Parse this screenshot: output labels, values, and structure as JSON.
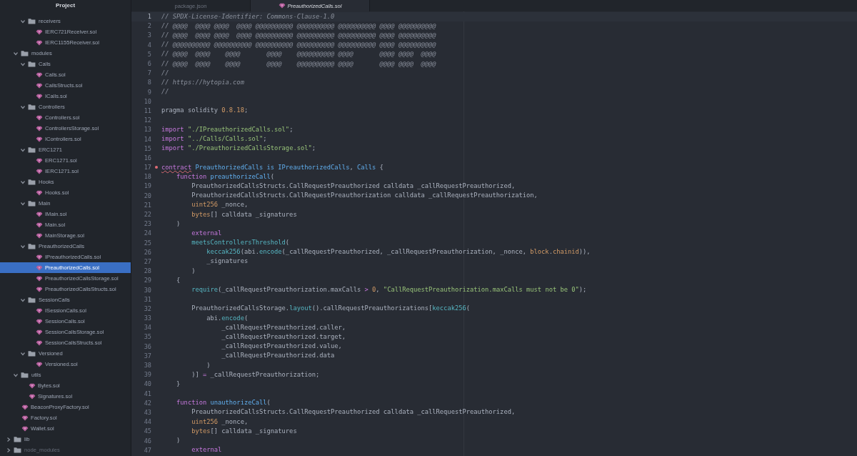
{
  "sidebar": {
    "title": "Project",
    "tree": [
      {
        "kind": "folder",
        "children": [
          {
            "kind": "folder",
            "children": [
              {
                "kind": "folder",
                "label": "receivers",
                "expanded": true,
                "children": [
                  {
                    "kind": "file",
                    "label": "IERC721Receiver.sol",
                    "selected": false
                  },
                  {
                    "kind": "file",
                    "label": "IERC1155Receiver.sol",
                    "selected": false
                  }
                ]
              }
            ]
          },
          {
            "kind": "folder",
            "label": "modules",
            "expanded": true,
            "children": [
              {
                "kind": "folder",
                "label": "Calls",
                "expanded": true,
                "children": [
                  {
                    "kind": "file",
                    "label": "Calls.sol",
                    "selected": false
                  },
                  {
                    "kind": "file",
                    "label": "CallsStructs.sol",
                    "selected": false
                  },
                  {
                    "kind": "file",
                    "label": "ICalls.sol",
                    "selected": false
                  }
                ]
              },
              {
                "kind": "folder",
                "label": "Controllers",
                "expanded": true,
                "children": [
                  {
                    "kind": "file",
                    "label": "Controllers.sol",
                    "selected": false
                  },
                  {
                    "kind": "file",
                    "label": "ControllersStorage.sol",
                    "selected": false
                  },
                  {
                    "kind": "file",
                    "label": "IControllers.sol",
                    "selected": false
                  }
                ]
              },
              {
                "kind": "folder",
                "label": "ERC1271",
                "expanded": true,
                "children": [
                  {
                    "kind": "file",
                    "label": "ERC1271.sol",
                    "selected": false
                  },
                  {
                    "kind": "file",
                    "label": "IERC1271.sol",
                    "selected": false
                  }
                ]
              },
              {
                "kind": "folder",
                "label": "Hooks",
                "expanded": true,
                "children": [
                  {
                    "kind": "file",
                    "label": "Hooks.sol",
                    "selected": false
                  }
                ]
              },
              {
                "kind": "folder",
                "label": "Main",
                "expanded": true,
                "children": [
                  {
                    "kind": "file",
                    "label": "IMain.sol",
                    "selected": false
                  },
                  {
                    "kind": "file",
                    "label": "Main.sol",
                    "selected": false
                  },
                  {
                    "kind": "file",
                    "label": "MainStorage.sol",
                    "selected": false
                  }
                ]
              },
              {
                "kind": "folder",
                "label": "PreauthorizedCalls",
                "expanded": true,
                "children": [
                  {
                    "kind": "file",
                    "label": "IPreauthorizedCalls.sol",
                    "selected": false
                  },
                  {
                    "kind": "file",
                    "label": "PreauthorizedCalls.sol",
                    "selected": true
                  },
                  {
                    "kind": "file",
                    "label": "PreauthorizedCallsStorage.sol",
                    "selected": false
                  },
                  {
                    "kind": "file",
                    "label": "PreauthorizedCallsStructs.sol",
                    "selected": false
                  }
                ]
              },
              {
                "kind": "folder",
                "label": "SessionCalls",
                "expanded": true,
                "children": [
                  {
                    "kind": "file",
                    "label": "ISessionCalls.sol",
                    "selected": false
                  },
                  {
                    "kind": "file",
                    "label": "SessionCalls.sol",
                    "selected": false
                  },
                  {
                    "kind": "file",
                    "label": "SessionCallsStorage.sol",
                    "selected": false
                  },
                  {
                    "kind": "file",
                    "label": "SessionCallsStructs.sol",
                    "selected": false
                  }
                ]
              },
              {
                "kind": "folder",
                "label": "Versioned",
                "expanded": true,
                "children": [
                  {
                    "kind": "file",
                    "label": "Versioned.sol",
                    "selected": false
                  }
                ]
              }
            ]
          },
          {
            "kind": "folder",
            "label": "utils",
            "expanded": true,
            "children": [
              {
                "kind": "file",
                "label": "Bytes.sol",
                "selected": false
              },
              {
                "kind": "file",
                "label": "Signatures.sol",
                "selected": false
              }
            ]
          },
          {
            "kind": "file",
            "label": "BeaconProxyFactory.sol",
            "selected": false
          },
          {
            "kind": "file",
            "label": "Factory.sol",
            "selected": false
          },
          {
            "kind": "file",
            "label": "Wallet.sol",
            "selected": false
          }
        ]
      },
      {
        "kind": "folder",
        "label": "lib",
        "expanded": false
      },
      {
        "kind": "folder",
        "label": "node_modules",
        "expanded": false,
        "ignored": true
      }
    ]
  },
  "tabs": [
    {
      "label": "package.json",
      "kind": "plain",
      "selected": false
    },
    {
      "label": "PreauthorizedCalls.sol",
      "kind": "solidity",
      "selected": true
    }
  ],
  "editor": {
    "lines": [
      {
        "number": "1",
        "current": true,
        "error": false,
        "tokens": [
          {
            "kind": "comment",
            "text": "// SPDX-License-Identifier: Commons-Clause-1.0"
          }
        ]
      },
      {
        "number": "2",
        "current": false,
        "error": false,
        "tokens": [
          {
            "kind": "comment",
            "text": "// @@@@  @@@@ @@@@  @@@@ @@@@@@@@@@ @@@@@@@@@@ @@@@@@@@@@ @@@@ @@@@@@@@@@"
          }
        ]
      },
      {
        "number": "3",
        "current": false,
        "error": false,
        "tokens": [
          {
            "kind": "comment",
            "text": "// @@@@  @@@@ @@@@  @@@@ @@@@@@@@@@ @@@@@@@@@@ @@@@@@@@@@ @@@@ @@@@@@@@@@"
          }
        ]
      },
      {
        "number": "4",
        "current": false,
        "error": false,
        "tokens": [
          {
            "kind": "comment",
            "text": "// @@@@@@@@@@ @@@@@@@@@@ @@@@@@@@@@ @@@@@@@@@@ @@@@@@@@@@ @@@@ @@@@@@@@@@"
          }
        ]
      },
      {
        "number": "5",
        "current": false,
        "error": false,
        "tokens": [
          {
            "kind": "comment",
            "text": "// @@@@  @@@@    @@@@       @@@@    @@@@@@@@@@ @@@@       @@@@ @@@@  @@@@"
          }
        ]
      },
      {
        "number": "6",
        "current": false,
        "error": false,
        "tokens": [
          {
            "kind": "comment",
            "text": "// @@@@  @@@@    @@@@       @@@@    @@@@@@@@@@ @@@@       @@@@ @@@@  @@@@"
          }
        ]
      },
      {
        "number": "7",
        "current": false,
        "error": false,
        "tokens": [
          {
            "kind": "comment",
            "text": "//"
          }
        ]
      },
      {
        "number": "8",
        "current": false,
        "error": false,
        "tokens": [
          {
            "kind": "comment",
            "text": "// https://hytopia.com"
          }
        ]
      },
      {
        "number": "9",
        "current": false,
        "error": false,
        "tokens": [
          {
            "kind": "comment",
            "text": "//"
          }
        ]
      },
      {
        "number": "10",
        "current": false,
        "error": false
      },
      {
        "number": "11",
        "current": false,
        "error": false,
        "tokens": [
          {
            "kind": "plain",
            "text": "pragma solidity "
          },
          {
            "kind": "number",
            "text": "0.8.18"
          },
          {
            "kind": "plain",
            "text": ";"
          }
        ]
      },
      {
        "number": "12",
        "current": false,
        "error": false
      },
      {
        "number": "13",
        "current": false,
        "error": false,
        "tokens": [
          {
            "kind": "keyword",
            "text": "import "
          },
          {
            "kind": "string",
            "text": "\"./IPreauthorizedCalls.sol\""
          },
          {
            "kind": "plain",
            "text": ";"
          }
        ]
      },
      {
        "number": "14",
        "current": false,
        "error": false,
        "tokens": [
          {
            "kind": "keyword",
            "text": "import "
          },
          {
            "kind": "string",
            "text": "\"../Calls/Calls.sol\""
          },
          {
            "kind": "plain",
            "text": ";"
          }
        ]
      },
      {
        "number": "15",
        "current": false,
        "error": false,
        "tokens": [
          {
            "kind": "keyword",
            "text": "import "
          },
          {
            "kind": "string",
            "text": "\"./PreauthorizedCallsStorage.sol\""
          },
          {
            "kind": "plain",
            "text": ";"
          }
        ]
      },
      {
        "number": "16",
        "current": false,
        "error": false
      },
      {
        "number": "17",
        "current": false,
        "error": true,
        "tokens": [
          {
            "kind": "keyword",
            "text": "contract"
          },
          {
            "kind": "name",
            "text": " PreauthorizedCalls is IPreauthorizedCalls"
          },
          {
            "kind": "plain",
            "text": ", "
          },
          {
            "kind": "name",
            "text": "Calls"
          },
          {
            "kind": "plain",
            "text": " {"
          }
        ]
      },
      {
        "number": "18",
        "current": false,
        "error": false,
        "tokens": [
          {
            "kind": "keyword",
            "text": "    function"
          },
          {
            "kind": "name",
            "text": " preauthorizeCall"
          },
          {
            "kind": "plain",
            "text": "("
          }
        ]
      },
      {
        "number": "19",
        "current": false,
        "error": false,
        "tokens": [
          {
            "kind": "plain",
            "text": "        PreauthorizedCallsStructs.CallRequestPreauthorized calldata _callRequestPreauthorized,"
          }
        ]
      },
      {
        "number": "20",
        "current": false,
        "error": false,
        "tokens": [
          {
            "kind": "plain",
            "text": "        PreauthorizedCallsStructs.CallRequestPreauthorization calldata _callRequestPreauthorization,"
          }
        ]
      },
      {
        "number": "21",
        "current": false,
        "error": false,
        "tokens": [
          {
            "kind": "type",
            "text": "        uint256"
          },
          {
            "kind": "plain",
            "text": " _nonce,"
          }
        ]
      },
      {
        "number": "22",
        "current": false,
        "error": false,
        "tokens": [
          {
            "kind": "type",
            "text": "        bytes"
          },
          {
            "kind": "plain",
            "text": "[] calldata _signatures"
          }
        ]
      },
      {
        "number": "23",
        "current": false,
        "error": false,
        "tokens": [
          {
            "kind": "plain",
            "text": "    )"
          }
        ]
      },
      {
        "number": "24",
        "current": false,
        "error": false,
        "tokens": [
          {
            "kind": "keyword",
            "text": "        external"
          }
        ]
      },
      {
        "number": "25",
        "current": false,
        "error": false,
        "tokens": [
          {
            "kind": "call",
            "text": "        meetsControllersThreshold"
          },
          {
            "kind": "plain",
            "text": "("
          }
        ]
      },
      {
        "number": "26",
        "current": false,
        "error": false,
        "tokens": [
          {
            "kind": "call",
            "text": "            keccak256"
          },
          {
            "kind": "plain",
            "text": "(abi."
          },
          {
            "kind": "call",
            "text": "encode"
          },
          {
            "kind": "plain",
            "text": "(_callRequestPreauthorized, _callRequestPreauthorization, _nonce, "
          },
          {
            "kind": "type",
            "text": "block"
          },
          {
            "kind": "plain",
            "text": "."
          },
          {
            "kind": "type",
            "text": "chainid"
          },
          {
            "kind": "plain",
            "text": ")),"
          }
        ]
      },
      {
        "number": "27",
        "current": false,
        "error": false,
        "tokens": [
          {
            "kind": "plain",
            "text": "            _signatures"
          }
        ]
      },
      {
        "number": "28",
        "current": false,
        "error": false,
        "tokens": [
          {
            "kind": "plain",
            "text": "        )"
          }
        ]
      },
      {
        "number": "29",
        "current": false,
        "error": false,
        "tokens": [
          {
            "kind": "plain",
            "text": "    {"
          }
        ]
      },
      {
        "number": "30",
        "current": false,
        "error": false,
        "tokens": [
          {
            "kind": "call",
            "text": "        require"
          },
          {
            "kind": "plain",
            "text": "(_callRequestPreauthorization.maxCalls "
          },
          {
            "kind": "operator",
            "text": ">"
          },
          {
            "kind": "number",
            "text": " 0"
          },
          {
            "kind": "plain",
            "text": ", "
          },
          {
            "kind": "string",
            "text": "\"CallRequestPreauthorization.maxCalls must not be 0\""
          },
          {
            "kind": "plain",
            "text": ");"
          }
        ]
      },
      {
        "number": "31",
        "current": false,
        "error": false
      },
      {
        "number": "32",
        "current": false,
        "error": false,
        "tokens": [
          {
            "kind": "plain",
            "text": "        PreauthorizedCallsStorage."
          },
          {
            "kind": "call",
            "text": "layout"
          },
          {
            "kind": "plain",
            "text": "().callRequestPreauthorizations["
          },
          {
            "kind": "call",
            "text": "keccak256"
          },
          {
            "kind": "plain",
            "text": "("
          }
        ]
      },
      {
        "number": "33",
        "current": false,
        "error": false,
        "tokens": [
          {
            "kind": "plain",
            "text": "            abi."
          },
          {
            "kind": "call",
            "text": "encode"
          },
          {
            "kind": "plain",
            "text": "("
          }
        ]
      },
      {
        "number": "34",
        "current": false,
        "error": false,
        "tokens": [
          {
            "kind": "plain",
            "text": "                _callRequestPreauthorized.caller,"
          }
        ]
      },
      {
        "number": "35",
        "current": false,
        "error": false,
        "tokens": [
          {
            "kind": "plain",
            "text": "                _callRequestPreauthorized.target,"
          }
        ]
      },
      {
        "number": "36",
        "current": false,
        "error": false,
        "tokens": [
          {
            "kind": "plain",
            "text": "                _callRequestPreauthorized.value,"
          }
        ]
      },
      {
        "number": "37",
        "current": false,
        "error": false,
        "tokens": [
          {
            "kind": "plain",
            "text": "                _callRequestPreauthorized.data"
          }
        ]
      },
      {
        "number": "38",
        "current": false,
        "error": false,
        "tokens": [
          {
            "kind": "plain",
            "text": "            )"
          }
        ]
      },
      {
        "number": "39",
        "current": false,
        "error": false,
        "tokens": [
          {
            "kind": "plain",
            "text": "        )] "
          },
          {
            "kind": "operator",
            "text": "="
          },
          {
            "kind": "plain",
            "text": " _callRequestPreauthorization;"
          }
        ]
      },
      {
        "number": "40",
        "current": false,
        "error": false,
        "tokens": [
          {
            "kind": "plain",
            "text": "    }"
          }
        ]
      },
      {
        "number": "41",
        "current": false,
        "error": false
      },
      {
        "number": "42",
        "current": false,
        "error": false,
        "tokens": [
          {
            "kind": "keyword",
            "text": "    function"
          },
          {
            "kind": "name",
            "text": " unauthorizeCall"
          },
          {
            "kind": "plain",
            "text": "("
          }
        ]
      },
      {
        "number": "43",
        "current": false,
        "error": false,
        "tokens": [
          {
            "kind": "plain",
            "text": "        PreauthorizedCallsStructs.CallRequestPreauthorized calldata _callRequestPreauthorized,"
          }
        ]
      },
      {
        "number": "44",
        "current": false,
        "error": false,
        "tokens": [
          {
            "kind": "type",
            "text": "        uint256"
          },
          {
            "kind": "plain",
            "text": " _nonce,"
          }
        ]
      },
      {
        "number": "45",
        "current": false,
        "error": false,
        "tokens": [
          {
            "kind": "type",
            "text": "        bytes"
          },
          {
            "kind": "plain",
            "text": "[] calldata _signatures"
          }
        ]
      },
      {
        "number": "46",
        "current": false,
        "error": false,
        "tokens": [
          {
            "kind": "plain",
            "text": "    )"
          }
        ]
      },
      {
        "number": "47",
        "current": false,
        "error": false,
        "tokens": [
          {
            "kind": "keyword",
            "text": "        external"
          }
        ]
      }
    ]
  }
}
